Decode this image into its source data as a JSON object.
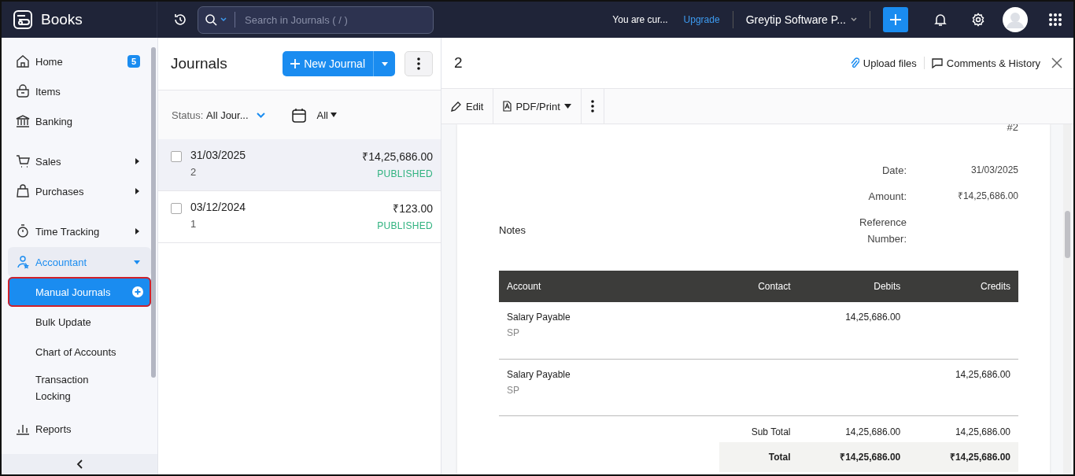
{
  "app": {
    "name": "Books"
  },
  "topbar": {
    "search_placeholder": "Search in Journals ( / )",
    "trial_text": "You are cur...",
    "upgrade_link": "Upgrade",
    "org_name": "Greytip Software P..."
  },
  "sidebar": {
    "sections": [
      [
        {
          "label": "Home",
          "kind": "link",
          "badge": "5"
        },
        {
          "label": "Items",
          "kind": "link"
        },
        {
          "label": "Banking",
          "kind": "link"
        }
      ],
      [
        {
          "label": "Sales",
          "kind": "group",
          "expanded": false
        },
        {
          "label": "Purchases",
          "kind": "group",
          "expanded": false
        }
      ],
      [
        {
          "label": "Time Tracking",
          "kind": "group",
          "expanded": false
        }
      ],
      [
        {
          "label": "Accountant",
          "kind": "group",
          "expanded": true,
          "children": [
            {
              "label": "Manual Journals",
              "selected": true
            },
            {
              "label": "Bulk Update",
              "selected": false
            },
            {
              "label": "Chart of Accounts",
              "selected": false
            },
            {
              "label": "Transaction Locking",
              "selected": false
            }
          ]
        }
      ],
      [
        {
          "label": "Reports",
          "kind": "link"
        }
      ]
    ]
  },
  "list": {
    "title": "Journals",
    "new_button": "New Journal",
    "filter_label": "Status:",
    "filter_value": "All Jour...",
    "period": "All",
    "rows": [
      {
        "date": "31/03/2025",
        "number": "2",
        "amount": "₹14,25,686.00",
        "status": "PUBLISHED",
        "checked": false,
        "selected": true
      },
      {
        "date": "03/12/2024",
        "number": "1",
        "amount": "₹123.00",
        "status": "PUBLISHED",
        "checked": false,
        "selected": false
      }
    ]
  },
  "detail": {
    "title": "2",
    "upload": "Upload files",
    "comments": "Comments & History",
    "edit": "Edit",
    "pdf": "PDF/Print",
    "doc": {
      "number": "#2",
      "notes_label": "Notes",
      "fields": [
        {
          "label": "Date:",
          "value": "31/03/2025"
        },
        {
          "label": "Amount:",
          "value": "₹14,25,686.00"
        },
        {
          "label": "Reference Number:"
        }
      ],
      "columns": [
        "Account",
        "Contact",
        "Debits",
        "Credits"
      ],
      "rows": [
        {
          "account": "Salary Payable",
          "code": "SP",
          "debit": "14,25,686.00"
        },
        {
          "account": "Salary Payable",
          "code": "SP",
          "credit": "14,25,686.00"
        }
      ],
      "sub_total": {
        "label": "Sub Total",
        "debit": "14,25,686.00",
        "credit": "14,25,686.00"
      },
      "total": {
        "label": "Total",
        "debit": "₹14,25,686.00",
        "credit": "₹14,25,686.00"
      }
    }
  }
}
